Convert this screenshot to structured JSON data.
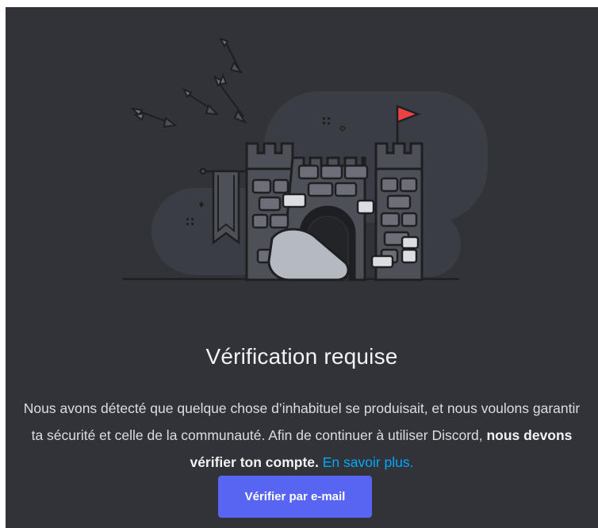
{
  "modal": {
    "title": "Vérification requise",
    "description": {
      "part1": "Nous avons détecté que quelque chose d’inhabituel se produisait, et nous voulons garantir ta sécurité et celle de la communauté. Afin de continuer à utiliser Discord, ",
      "bold": "nous devons vérifier ton compte.",
      "link": "En savoir plus."
    },
    "verify_button": "Vérifier par e-mail"
  },
  "colors": {
    "background": "#313338",
    "button": "#5865f2",
    "link": "#00a8fc",
    "flag": "#ed4245"
  }
}
